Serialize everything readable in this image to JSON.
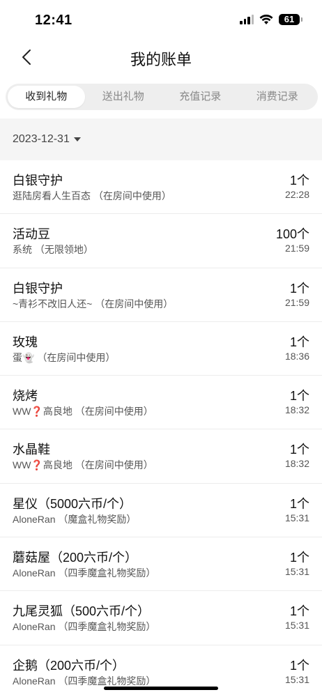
{
  "status_bar": {
    "time": "12:41",
    "battery": "61"
  },
  "header": {
    "title": "我的账单"
  },
  "tabs": [
    {
      "label": "收到礼物",
      "active": true
    },
    {
      "label": "送出礼物",
      "active": false
    },
    {
      "label": "充值记录",
      "active": false
    },
    {
      "label": "消费记录",
      "active": false
    }
  ],
  "date_filter": {
    "value": "2023-12-31"
  },
  "records": [
    {
      "name": "白银守护",
      "from": "逛陆房看人生百态 （在房间中使用）",
      "qty": "1个",
      "time": "22:28"
    },
    {
      "name": "活动豆",
      "from": "系统 （无限领地）",
      "qty": "100个",
      "time": "21:59"
    },
    {
      "name": "白银守护",
      "from": "~青衫不改旧人还~ （在房间中使用）",
      "qty": "1个",
      "time": "21:59"
    },
    {
      "name": "玫瑰",
      "from": "蛋👻 （在房间中使用）",
      "qty": "1个",
      "time": "18:36"
    },
    {
      "name": "烧烤",
      "from": "WW❓高良地 （在房间中使用）",
      "qty": "1个",
      "time": "18:32"
    },
    {
      "name": "水晶鞋",
      "from": "WW❓高良地 （在房间中使用）",
      "qty": "1个",
      "time": "18:32"
    },
    {
      "name": "星仪（5000六币/个）",
      "from": "AloneRan （魔盒礼物奖励）",
      "qty": "1个",
      "time": "15:31"
    },
    {
      "name": "蘑菇屋（200六币/个）",
      "from": "AloneRan （四季魔盒礼物奖励）",
      "qty": "1个",
      "time": "15:31"
    },
    {
      "name": "九尾灵狐（500六币/个）",
      "from": "AloneRan （四季魔盒礼物奖励）",
      "qty": "1个",
      "time": "15:31"
    },
    {
      "name": "企鹅（200六币/个）",
      "from": "AloneRan （四季魔盒礼物奖励）",
      "qty": "1个",
      "time": "15:31"
    }
  ]
}
